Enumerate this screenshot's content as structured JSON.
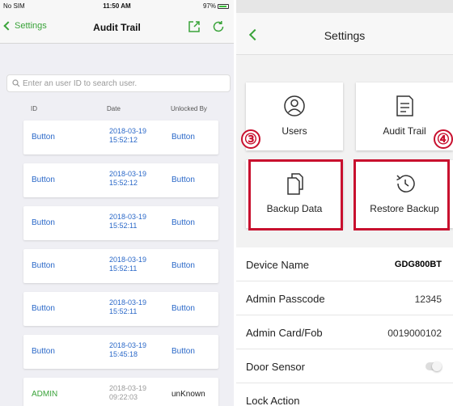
{
  "left": {
    "status": {
      "carrier": "No SIM",
      "time": "11:50 AM",
      "battery": "97%"
    },
    "nav": {
      "back_label": "Settings",
      "title": "Audit Trail"
    },
    "search": {
      "placeholder": "Enter an user ID to search user."
    },
    "columns": {
      "id": "ID",
      "date": "Date",
      "unlocked_by": "Unlocked By"
    },
    "rows": [
      {
        "id": "Button",
        "date_line1": "2018-03-19",
        "date_line2": "15:52:12",
        "unlocked_by": "Button"
      },
      {
        "id": "Button",
        "date_line1": "2018-03-19",
        "date_line2": "15:52:12",
        "unlocked_by": "Button"
      },
      {
        "id": "Button",
        "date_line1": "2018-03-19",
        "date_line2": "15:52:11",
        "unlocked_by": "Button"
      },
      {
        "id": "Button",
        "date_line1": "2018-03-19",
        "date_line2": "15:52:11",
        "unlocked_by": "Button"
      },
      {
        "id": "Button",
        "date_line1": "2018-03-19",
        "date_line2": "15:52:11",
        "unlocked_by": "Button"
      },
      {
        "id": "Button",
        "date_line1": "2018-03-19",
        "date_line2": "15:45:18",
        "unlocked_by": "Button"
      },
      {
        "id": "ADMIN",
        "date_line1": "2018-03-19",
        "date_line2": "09:22:03",
        "unlocked_by": "unKnown"
      }
    ]
  },
  "right": {
    "nav": {
      "title": "Settings"
    },
    "tiles": {
      "users": "Users",
      "audit_trail": "Audit Trail",
      "backup_data": "Backup Data",
      "restore_backup": "Restore Backup"
    },
    "callouts": {
      "backup": "③",
      "restore": "④"
    },
    "settings": {
      "device_name_label": "Device Name",
      "device_name_value": "GDG800BT",
      "admin_passcode_label": "Admin Passcode",
      "admin_passcode_value": "12345",
      "admin_card_label": "Admin Card/Fob",
      "admin_card_value": "0019000102",
      "door_sensor_label": "Door Sensor",
      "lock_action_label": "Lock Action"
    }
  },
  "colors": {
    "accent_green": "#3aa33a",
    "link_blue": "#2a68c8",
    "callout_red": "#c8102e"
  }
}
